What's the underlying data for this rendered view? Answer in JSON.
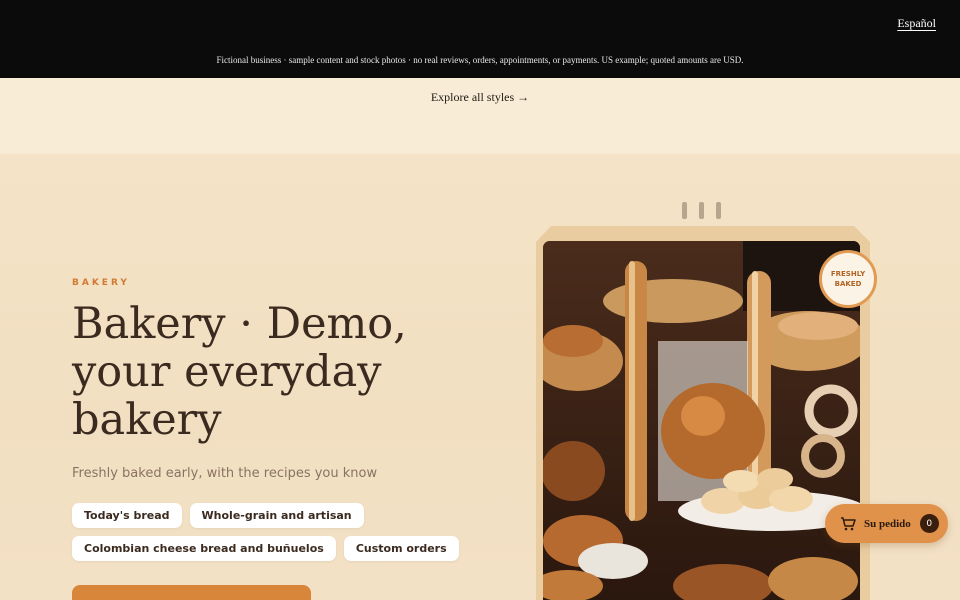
{
  "topbar": {
    "language_link": "Español",
    "disclaimer": "Fictional business · sample content and stock photos · no real reviews, orders, appointments, or payments. US example; quoted amounts are USD."
  },
  "explore": {
    "link": "Explore all styles →"
  },
  "hero": {
    "eyebrow": "BAKERY",
    "title": "Bakery · Demo, your everyday bakery",
    "subtitle": "Freshly baked early, with the recipes you know",
    "chips": [
      "Today's bread",
      "Whole-grain and artisan",
      "Colombian cheese bread and buñuelos",
      "Custom orders"
    ],
    "badge": "FRESHLY BAKED"
  },
  "order": {
    "label": "Su pedido",
    "count": "0"
  },
  "colors": {
    "accent": "#d8863a",
    "topbar": "#0b0b0b",
    "background": "#f4e3c7",
    "text": "#3b2a1f"
  },
  "icons": {
    "cart": "shopping-cart-icon"
  }
}
